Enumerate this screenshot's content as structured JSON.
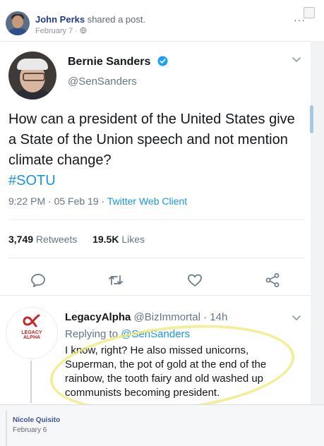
{
  "fb_post": {
    "author": "John Perks",
    "action": " shared a post.",
    "date": "February 7 · ",
    "more": "···"
  },
  "tweet": {
    "display_name": "Bernie Sanders",
    "handle": "@SenSanders",
    "text": "How can a president of the United States give a State of the Union speech and not mention climate change?",
    "hashtag": "#SOTU",
    "time": "9:22 PM · 05 Feb 19 · ",
    "client": "Twitter Web Client",
    "retweets_count": "3,749",
    "retweets_label": " Retweets",
    "likes_count": "19.5K",
    "likes_label": " Likes"
  },
  "reply": {
    "display_name": "LegacyAlpha",
    "handle": " @BizImmortal · 14h",
    "replying_prefix": "Replying to ",
    "replying_to": "@SenSanders",
    "text": "I know, right? He also missed unicorns, Superman, the pot of gold at the end of the rainbow, the tooth fairy and old washed up communists becoming president.",
    "logo_text": "LEGACY ALPHA"
  },
  "footer": {
    "name": "Nicole Quisito",
    "date": "February 6"
  },
  "colors": {
    "facebook_blue": "#385898",
    "twitter_blue": "#1b95e0",
    "highlight_yellow": "#eee878"
  }
}
